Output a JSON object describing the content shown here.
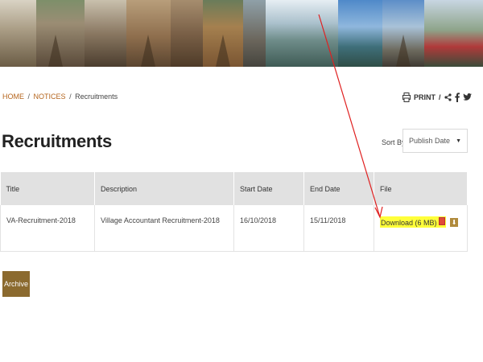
{
  "breadcrumb": {
    "home": "HOME",
    "notices": "NOTICES",
    "current": "Recruitments",
    "separator": "/"
  },
  "tools": {
    "print_label": "PRINT",
    "separator": "/",
    "icons": [
      "print-icon",
      "share-icon",
      "facebook-icon",
      "twitter-icon"
    ]
  },
  "page": {
    "title": "Recruitments"
  },
  "sort": {
    "label": "Sort By:",
    "selected": "Publish Date"
  },
  "table": {
    "headers": {
      "title": "Title",
      "description": "Description",
      "start_date": "Start Date",
      "end_date": "End Date",
      "file": "File"
    },
    "rows": [
      {
        "title": "VA-Recruitment-2018",
        "description": "Village Accountant Recruitment-2018",
        "start_date": "16/10/2018",
        "end_date": "15/11/2018",
        "file": "Download (6 MB)"
      }
    ]
  },
  "archive": {
    "label": "Archive"
  },
  "colors": {
    "breadcrumb_link": "#b5651d",
    "header_bg": "#e1e1e1",
    "archive_button": "#8b6a2f",
    "highlight": "#ffff3a",
    "annotation_arrow": "#e02020"
  }
}
